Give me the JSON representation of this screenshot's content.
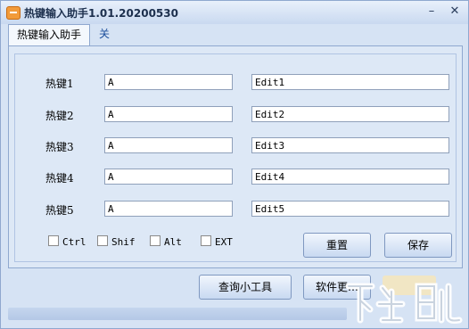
{
  "window": {
    "title": "热键输入助手1.01.20200530",
    "minimize": "–",
    "close": "✕"
  },
  "tabs": [
    {
      "label": "热键输入助手"
    },
    {
      "label": "关于"
    }
  ],
  "rows": [
    {
      "label": "热键1",
      "key": "A",
      "edit": "Edit1"
    },
    {
      "label": "热键2",
      "key": "A",
      "edit": "Edit2"
    },
    {
      "label": "热键3",
      "key": "A",
      "edit": "Edit3"
    },
    {
      "label": "热键4",
      "key": "A",
      "edit": "Edit4"
    },
    {
      "label": "热键5",
      "key": "A",
      "edit": "Edit5"
    }
  ],
  "modifiers": [
    {
      "label": "Ctrl",
      "checked": false
    },
    {
      "label": "Shif",
      "checked": false
    },
    {
      "label": "Alt",
      "checked": false
    },
    {
      "label": "EXT",
      "checked": false
    }
  ],
  "buttons": {
    "reset": "重置",
    "save": "保存",
    "query_tool": "查询小工具",
    "software_more": "软件更…"
  },
  "watermark": {
    "text": "下载吧"
  }
}
